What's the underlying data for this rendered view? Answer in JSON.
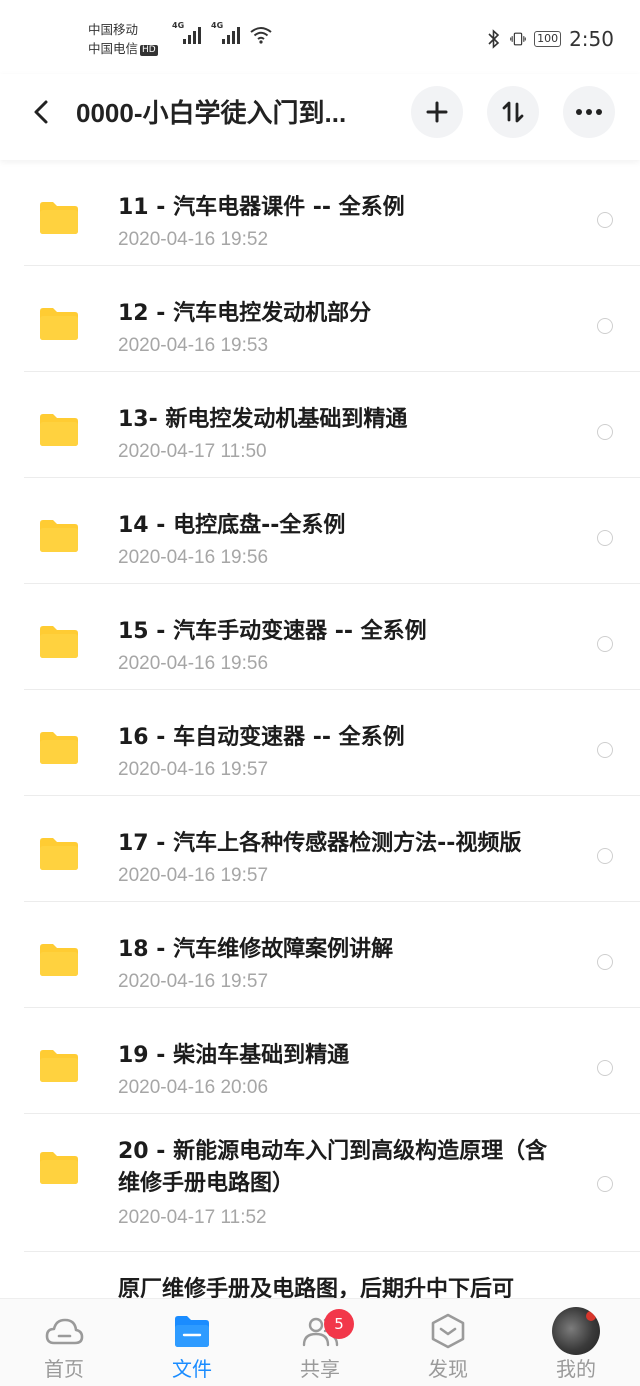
{
  "status_bar": {
    "carrier_1": "中国移动",
    "carrier_2": "中国电信",
    "hd": "HD",
    "network_1": "4G",
    "network_2": "4G",
    "battery": "100",
    "time": "2:50"
  },
  "header": {
    "title": "0000-小白学徒入门到...",
    "back_icon": "chevron-left-icon",
    "add_icon": "plus-icon",
    "sort_icon": "sort-icon",
    "more_icon": "more-dots-icon"
  },
  "files": [
    {
      "name": "11 - 汽车电器课件 --  全系例",
      "date": "2020-04-16  19:52"
    },
    {
      "name": "12 - 汽车电控发动机部分",
      "date": "2020-04-16  19:53"
    },
    {
      "name": "13- 新电控发动机基础到精通",
      "date": "2020-04-17  11:50"
    },
    {
      "name": "14 - 电控底盘--全系例",
      "date": "2020-04-16  19:56"
    },
    {
      "name": "15 - 汽车手动变速器 --  全系例",
      "date": "2020-04-16  19:56"
    },
    {
      "name": "16 - 车自动变速器 --  全系例",
      "date": "2020-04-16  19:57"
    },
    {
      "name": "17 - 汽车上各种传感器检测方法--视频版",
      "date": "2020-04-16  19:57"
    },
    {
      "name": "18 - 汽车维修故障案例讲解",
      "date": "2020-04-16  19:57"
    },
    {
      "name": "19 - 柴油车基础到精通",
      "date": "2020-04-16  20:06"
    },
    {
      "name": "20 - 新能源电动车入门到高级构造原理（含维修手册电路图）",
      "date": "2020-04-17  11:52"
    },
    {
      "name": "原厂维修手册及电路图，后期升中下后可",
      "date": ""
    }
  ],
  "bottom_nav": {
    "items": [
      {
        "label": "首页",
        "icon": "cloud-icon"
      },
      {
        "label": "文件",
        "icon": "folder-icon"
      },
      {
        "label": "共享",
        "icon": "people-icon"
      },
      {
        "label": "发现",
        "icon": "discover-hexagon-icon"
      },
      {
        "label": "我的",
        "icon": "avatar"
      }
    ],
    "share_badge": "5"
  },
  "colors": {
    "accent": "#1a8cff",
    "folder": "#ffcc33",
    "badge": "#f2374a"
  }
}
